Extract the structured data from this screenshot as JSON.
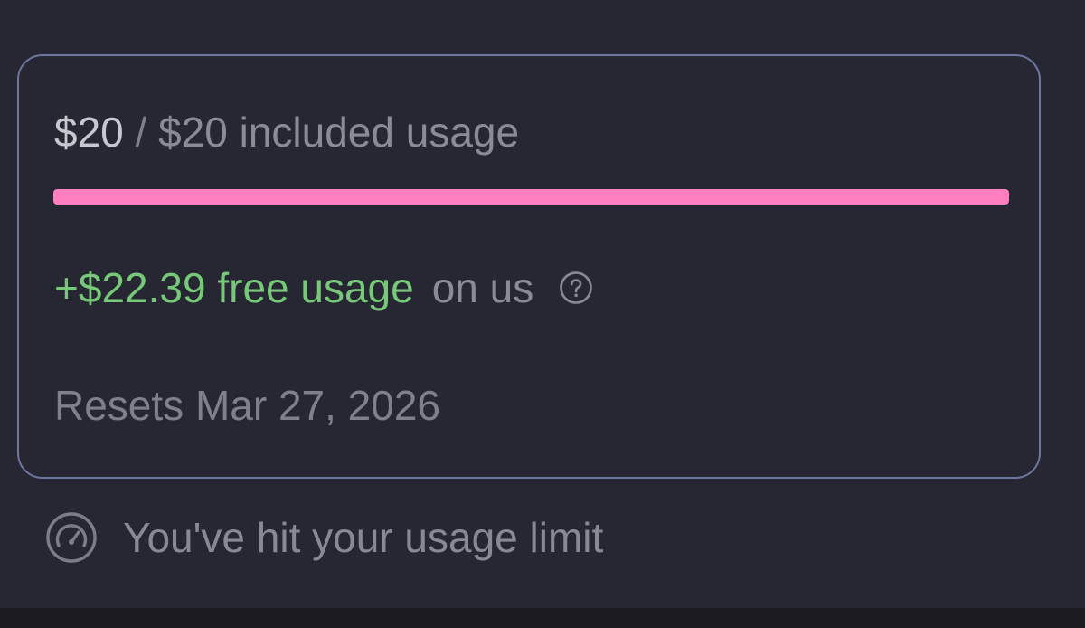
{
  "usage_card": {
    "used_amount": "$20",
    "separator": " / ",
    "included_label": "$20 included usage",
    "progress": {
      "fraction": 1.0,
      "color": "#ff7fc1"
    },
    "free_usage": {
      "amount_label": "+$22.39 free usage",
      "suffix": "on us",
      "color": "#77c878"
    },
    "help_icon": "question-circle-icon",
    "reset_text": "Resets Mar 27, 2026"
  },
  "limit_notice": {
    "icon": "gauge-icon",
    "text": "You've hit your usage limit"
  }
}
